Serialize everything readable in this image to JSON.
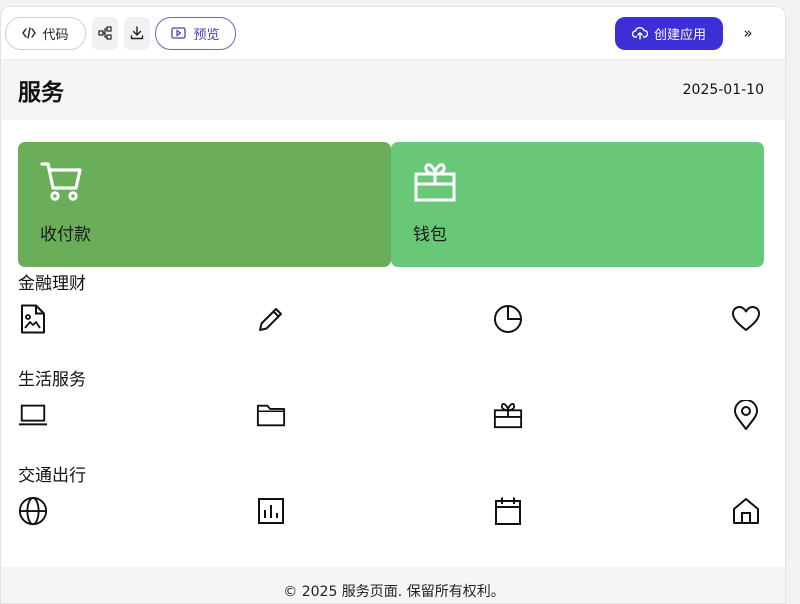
{
  "toolbar": {
    "code_label": "代码",
    "preview_label": "预览",
    "create_label": "创建应用",
    "more_label": "»"
  },
  "header": {
    "title": "服务",
    "date": "2025-01-10"
  },
  "cards": [
    {
      "label": "收付款",
      "icon": "cart-icon",
      "color": "#6aae5a"
    },
    {
      "label": "钱包",
      "icon": "gift-icon",
      "color": "#68c878"
    }
  ],
  "sections": [
    {
      "title": "金融理财",
      "icons": [
        "document-image-icon",
        "pencil-icon",
        "pie-chart-icon",
        "heart-icon"
      ]
    },
    {
      "title": "生活服务",
      "icons": [
        "laptop-icon",
        "folder-icon",
        "gift-icon",
        "map-pin-icon"
      ]
    },
    {
      "title": "交通出行",
      "icons": [
        "globe-icon",
        "bar-chart-icon",
        "calendar-icon",
        "home-icon"
      ]
    }
  ],
  "footer": {
    "text": "© 2025 服务页面. 保留所有权利。"
  },
  "colors": {
    "accent": "#3d2fd6",
    "card_green_dark": "#6aae5a",
    "card_green_light": "#68c878"
  }
}
